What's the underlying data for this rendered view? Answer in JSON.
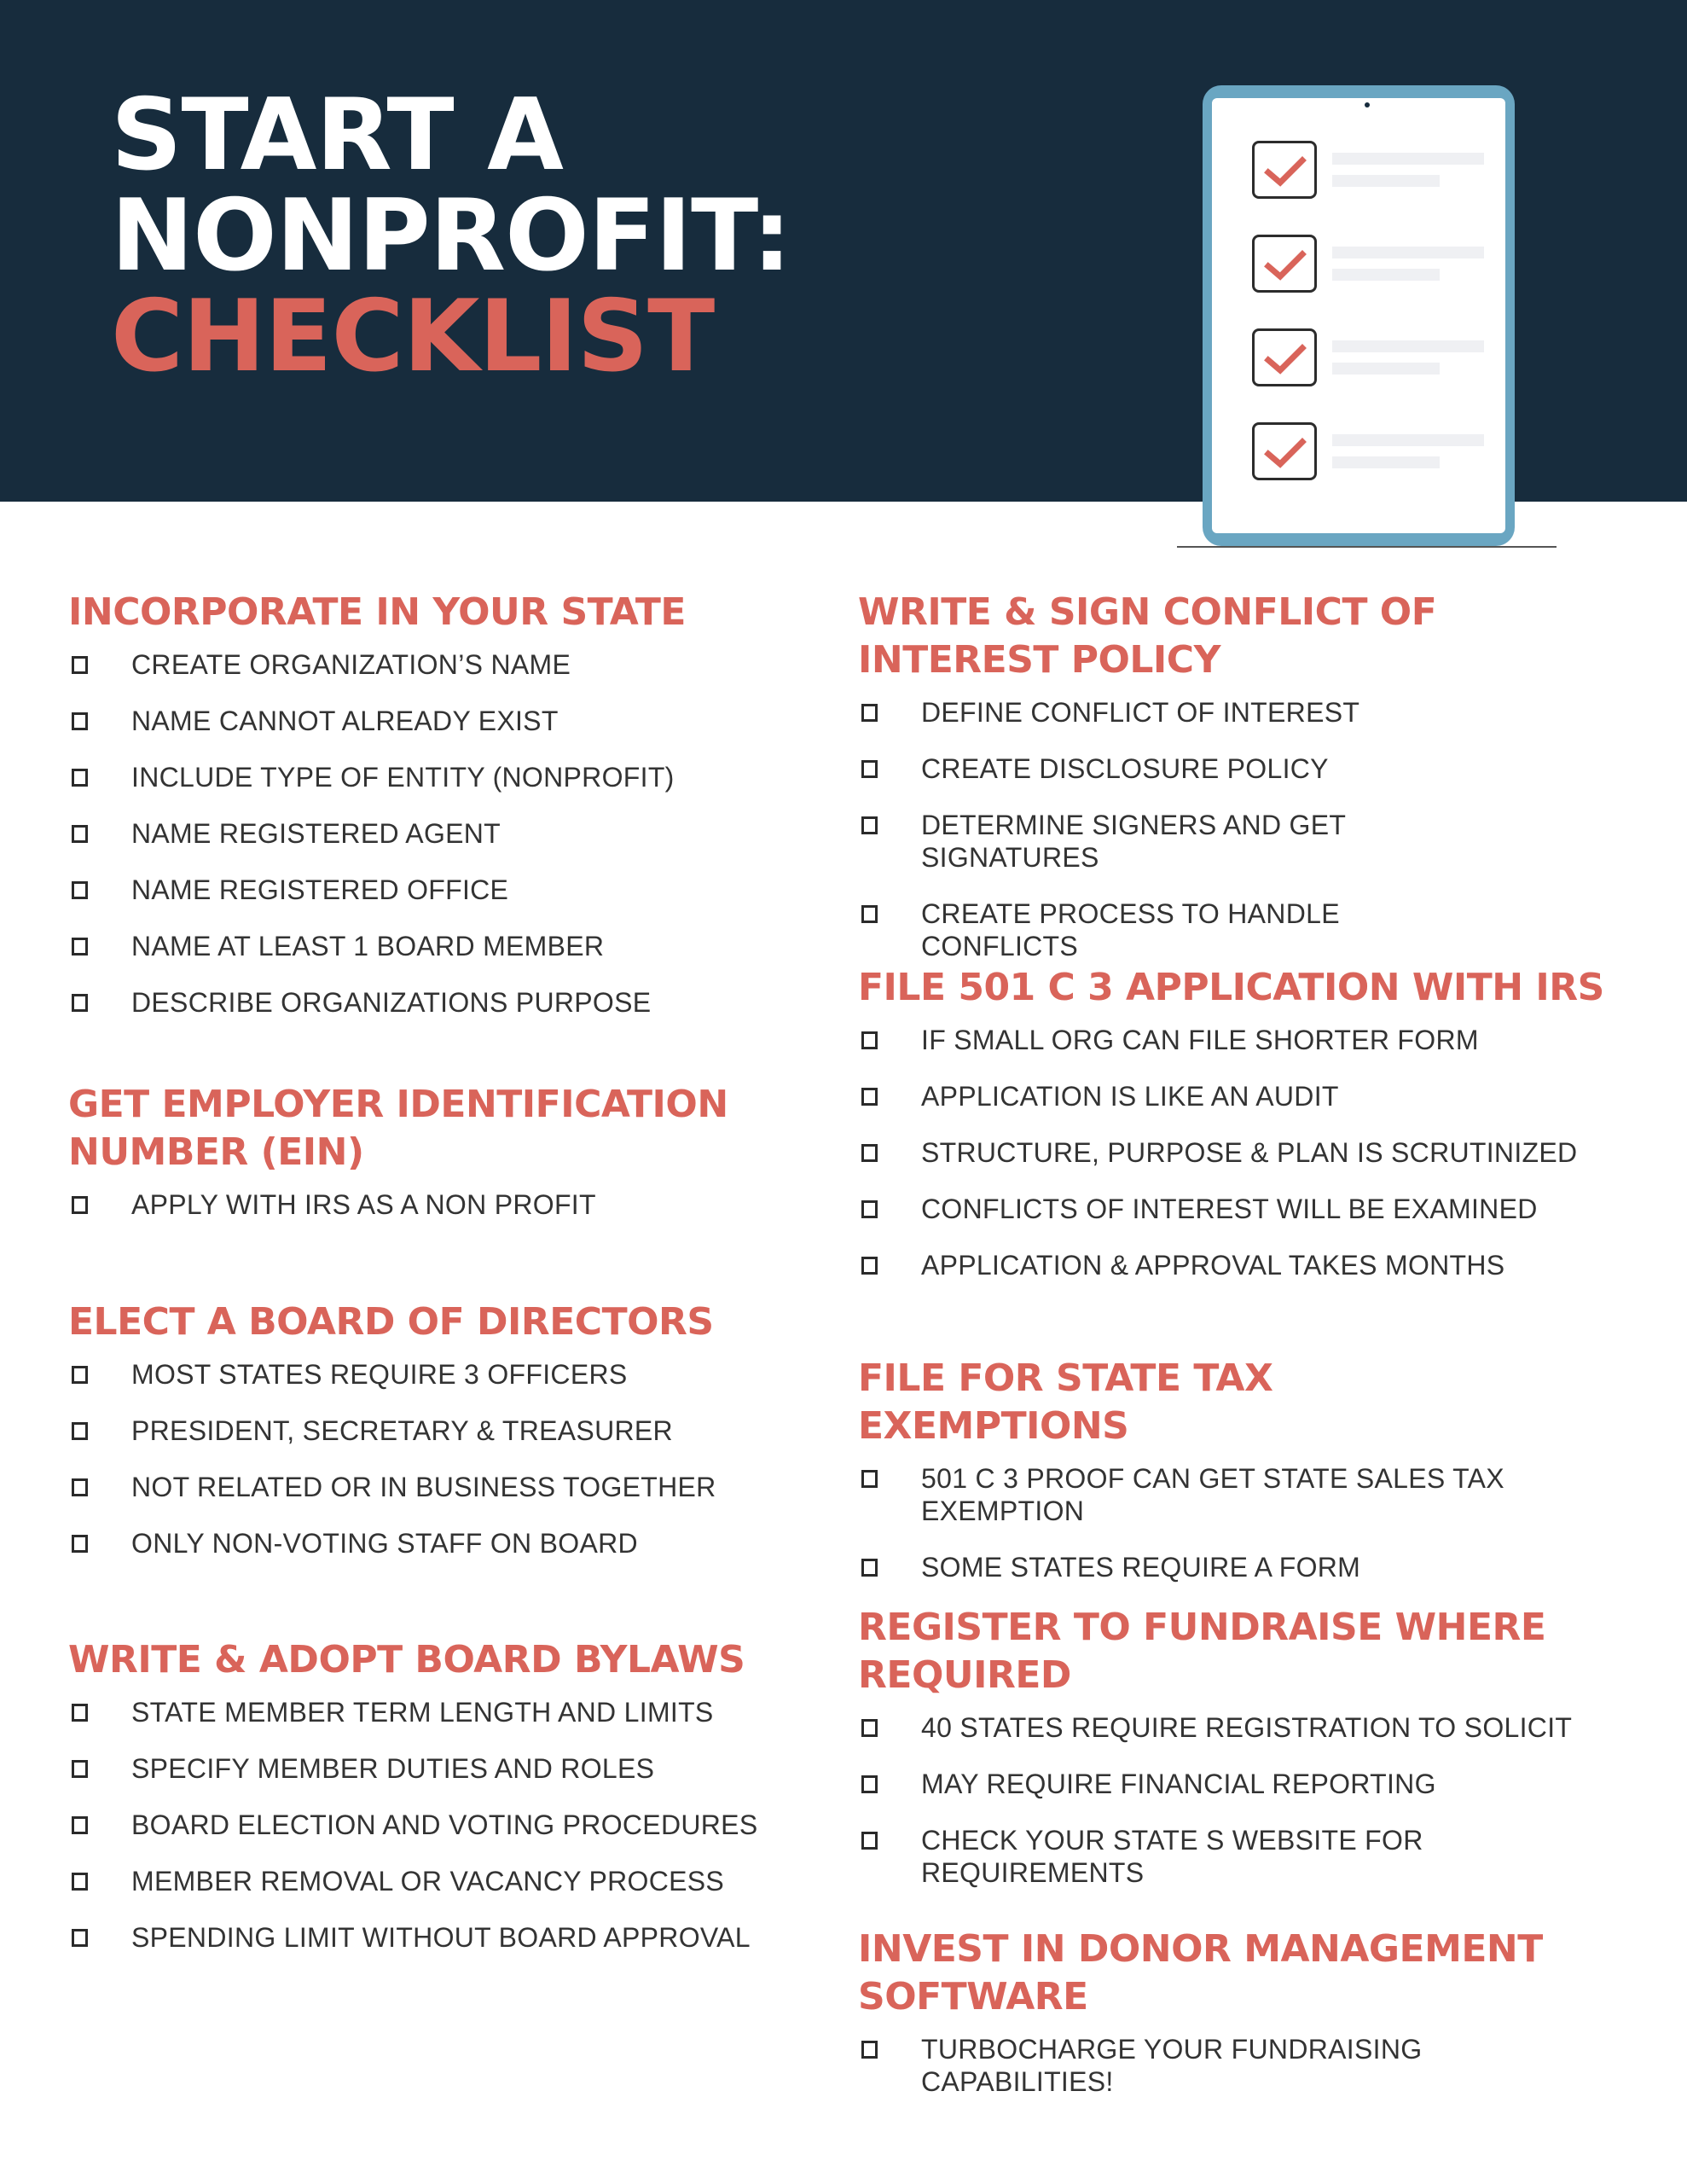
{
  "header": {
    "title_line1": "START A",
    "title_line2": "NONPROFIT:",
    "title_line3": "CHECKLIST",
    "background_color": "#172c3d",
    "accent_color": "#d9645a"
  },
  "illustration": {
    "type": "tablet-checklist",
    "checked_rows": 4,
    "check_icon": "checkmark-icon"
  },
  "left_column": [
    {
      "title": "INCORPORATE IN YOUR STATE",
      "items": [
        "CREATE ORGANIZATION’S NAME",
        "NAME CANNOT ALREADY EXIST",
        "INCLUDE TYPE OF ENTITY (NONPROFIT)",
        "NAME REGISTERED AGENT",
        "NAME REGISTERED OFFICE",
        "NAME AT LEAST 1 BOARD MEMBER",
        "DESCRIBE ORGANIZATIONS PURPOSE"
      ]
    },
    {
      "title": "GET EMPLOYER IDENTIFICATION NUMBER (EIN)",
      "items": [
        "APPLY WITH IRS AS A NON PROFIT"
      ]
    },
    {
      "title": "ELECT A BOARD OF DIRECTORS",
      "items": [
        "MOST STATES REQUIRE 3 OFFICERS",
        "PRESIDENT, SECRETARY & TREASURER",
        "NOT RELATED OR IN BUSINESS TOGETHER",
        "ONLY NON-VOTING STAFF ON BOARD"
      ]
    },
    {
      "title": "WRITE & ADOPT BOARD BYLAWS",
      "items": [
        "STATE MEMBER TERM LENGTH AND LIMITS",
        "SPECIFY MEMBER DUTIES AND ROLES",
        "BOARD ELECTION AND VOTING PROCEDURES",
        "MEMBER REMOVAL OR VACANCY PROCESS",
        "SPENDING LIMIT WITHOUT BOARD APPROVAL"
      ]
    }
  ],
  "right_column": [
    {
      "title": "WRITE & SIGN CONFLICT OF INTEREST POLICY",
      "items": [
        "DEFINE CONFLICT OF INTEREST",
        "CREATE DISCLOSURE POLICY",
        "DETERMINE SIGNERS AND GET SIGNATURES",
        "CREATE PROCESS TO HANDLE CONFLICTS"
      ]
    },
    {
      "title": "FILE 501 C 3 APPLICATION WITH IRS",
      "items": [
        "IF SMALL ORG CAN FILE SHORTER FORM",
        "APPLICATION IS LIKE AN AUDIT",
        "STRUCTURE, PURPOSE & PLAN IS SCRUTINIZED",
        "CONFLICTS OF INTEREST WILL BE EXAMINED",
        "APPLICATION & APPROVAL TAKES MONTHS"
      ]
    },
    {
      "title": "FILE FOR STATE TAX EXEMPTIONS",
      "items": [
        "501 C 3 PROOF CAN GET STATE SALES TAX EXEMPTION",
        "SOME STATES REQUIRE A FORM"
      ]
    },
    {
      "title": "REGISTER TO FUNDRAISE WHERE REQUIRED",
      "items": [
        "40 STATES REQUIRE REGISTRATION TO SOLICIT",
        "MAY REQUIRE FINANCIAL REPORTING",
        "CHECK YOUR STATE S WEBSITE FOR REQUIREMENTS"
      ]
    },
    {
      "title": "INVEST IN DONOR MANAGEMENT SOFTWARE",
      "items": [
        "TURBOCHARGE YOUR FUNDRAISING CAPABILITIES!"
      ]
    }
  ]
}
